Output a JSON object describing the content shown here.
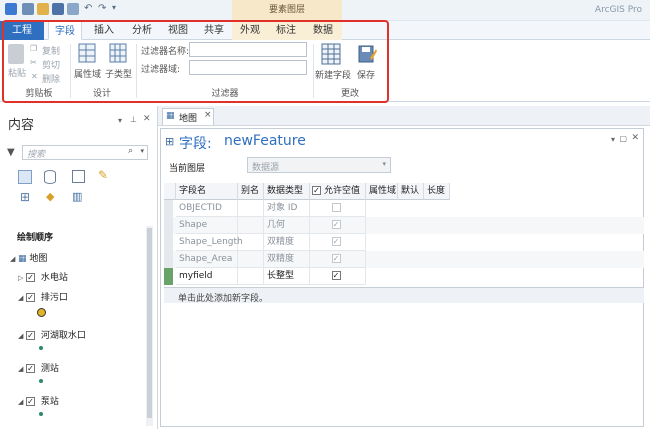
{
  "title_bar": {
    "context_label": "要素图层",
    "brand": "ArcGIS Pro"
  },
  "tabs": [
    {
      "label": "工程",
      "kind": "project"
    },
    {
      "label": "字段",
      "kind": "active"
    },
    {
      "label": "插入",
      "kind": "normal"
    },
    {
      "label": "分析",
      "kind": "normal"
    },
    {
      "label": "视图",
      "kind": "normal"
    },
    {
      "label": "共享",
      "kind": "normal"
    },
    {
      "label": "外观",
      "kind": "ctx"
    },
    {
      "label": "标注",
      "kind": "ctx"
    },
    {
      "label": "数据",
      "kind": "ctx"
    }
  ],
  "ribbon": {
    "clipboard": {
      "paste": "粘贴",
      "copy": "复制",
      "cut": "剪切",
      "delete": "删除",
      "group": "剪贴板"
    },
    "design": {
      "field_domains": "属性域",
      "subtypes": "子类型",
      "group": "设计"
    },
    "filter": {
      "name_label": "过滤器名称:",
      "domain_label": "过滤器域:",
      "group": "过滤器"
    },
    "changes": {
      "new_field": "新建字段",
      "save": "保存",
      "group": "更改"
    }
  },
  "contents": {
    "title": "内容",
    "search_placeholder": "搜索",
    "drawing_order": "绘制顺序",
    "map_label": "地图",
    "layers": [
      {
        "name": "水电站",
        "expanded": false,
        "checked": true
      },
      {
        "name": "排污口",
        "expanded": true,
        "checked": true
      },
      {
        "name": "河湖取水口",
        "expanded": true,
        "checked": true
      },
      {
        "name": "测站",
        "expanded": true,
        "checked": true
      },
      {
        "name": "泵站",
        "expanded": true,
        "checked": true
      }
    ]
  },
  "map_tab": {
    "label": "地图",
    "close": "×"
  },
  "fields_view": {
    "title_prefix": "字段:",
    "layer_name": "newFeature",
    "current_layer_label": "当前图层",
    "current_layer_value": "数据源",
    "columns": [
      "字段名",
      "别名",
      "数据类型",
      "允许空值",
      "属性域",
      "默认",
      "长度"
    ],
    "rows": [
      {
        "name": "OBJECTID",
        "alias": "",
        "type": "对象 ID",
        "nullable": false,
        "editable": false
      },
      {
        "name": "Shape",
        "alias": "",
        "type": "几何",
        "nullable": true,
        "editable": false
      },
      {
        "name": "Shape_Length",
        "alias": "",
        "type": "双精度",
        "nullable": true,
        "editable": false
      },
      {
        "name": "Shape_Area",
        "alias": "",
        "type": "双精度",
        "nullable": true,
        "editable": false
      },
      {
        "name": "myfield",
        "alias": "",
        "type": "长整型",
        "nullable": true,
        "editable": true
      }
    ],
    "add_hint": "单击此处添加新字段。"
  },
  "colors": {
    "accent": "#2f6fc0",
    "highlight": "#e0302a",
    "context_band": "#f6e8c8"
  }
}
